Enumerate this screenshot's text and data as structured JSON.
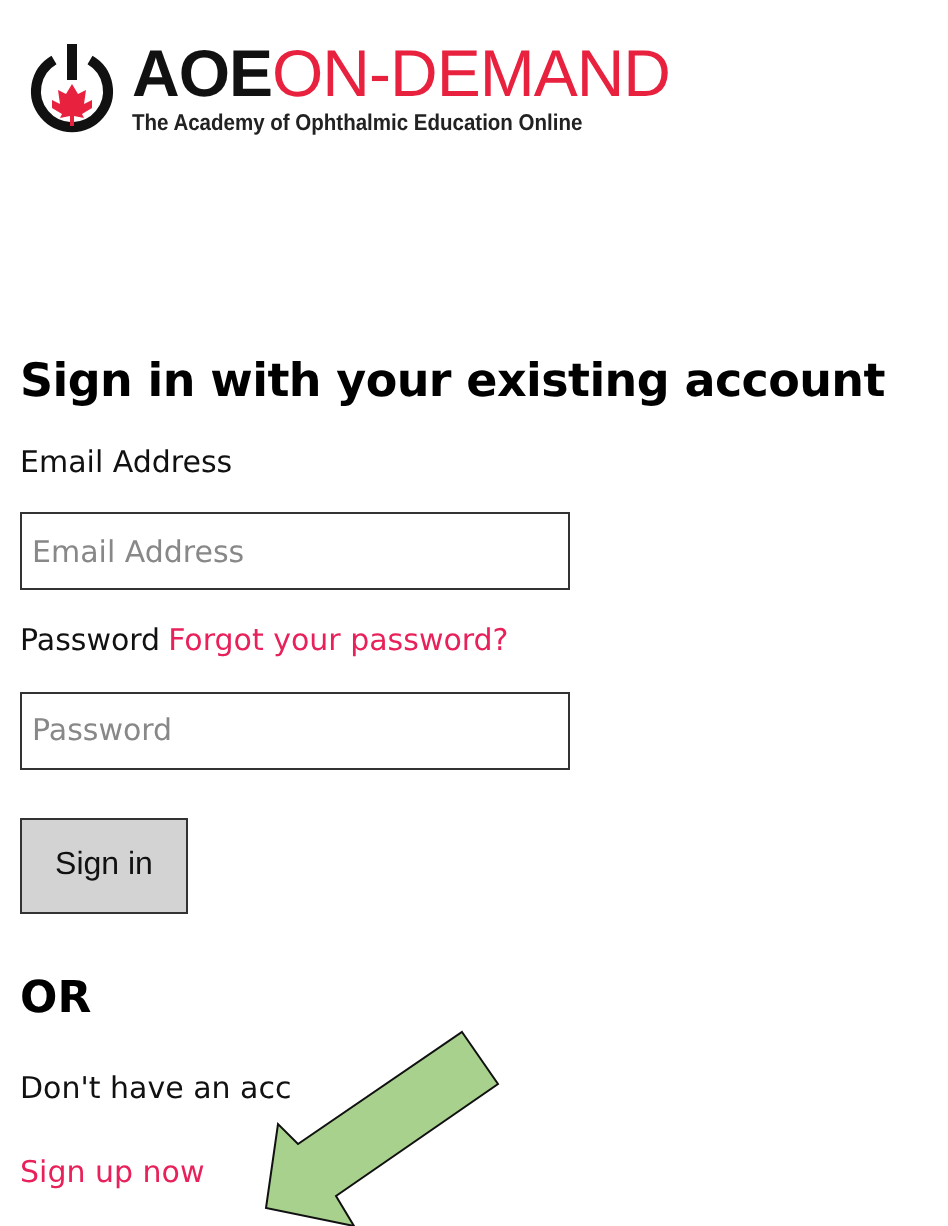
{
  "logo": {
    "brand_bold": "AOE",
    "brand_light": "ON-DEMAND",
    "tagline": "The Academy of Ophthalmic Education Online"
  },
  "heading": "Sign in with your existing account",
  "email": {
    "label": "Email Address",
    "placeholder": "Email Address"
  },
  "password": {
    "label": "Password",
    "forgot_link": "Forgot your password?",
    "placeholder": "Password"
  },
  "sign_in_button": "Sign in",
  "or_heading": "OR",
  "no_account_text": "Don't have an acc",
  "sign_up_link": "Sign up now"
}
